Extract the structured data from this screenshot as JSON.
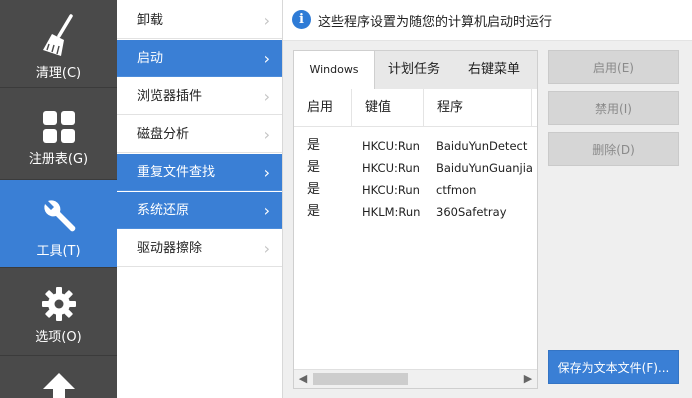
{
  "left_nav": [
    {
      "label": "清理(C)",
      "icon": "broom-icon"
    },
    {
      "label": "注册表(G)",
      "icon": "grid-icon"
    },
    {
      "label": "工具(T)",
      "icon": "wrench-icon",
      "active": true
    },
    {
      "label": "选项(O)",
      "icon": "gear-icon"
    },
    {
      "label": "",
      "icon": "up-arrow-icon"
    }
  ],
  "tools_nav": [
    {
      "label": "卸载"
    },
    {
      "label": "启动",
      "active": true
    },
    {
      "label": "浏览器插件"
    },
    {
      "label": "磁盘分析"
    },
    {
      "label": "重复文件查找",
      "active": true
    },
    {
      "label": "系统还原",
      "active": true
    },
    {
      "label": "驱动器擦除"
    }
  ],
  "info": {
    "text": "这些程序设置为随您的计算机启动时运行"
  },
  "tabs": [
    {
      "label": "Windows",
      "active": true
    },
    {
      "label": "计划任务"
    },
    {
      "label": "右键菜单"
    }
  ],
  "table": {
    "columns": [
      "启用",
      "键值",
      "程序"
    ],
    "rows": [
      {
        "enabled": "是",
        "key": "HKCU:Run",
        "program": "BaiduYunDetect"
      },
      {
        "enabled": "是",
        "key": "HKCU:Run",
        "program": "BaiduYunGuanjia"
      },
      {
        "enabled": "是",
        "key": "HKCU:Run",
        "program": "ctfmon"
      },
      {
        "enabled": "是",
        "key": "HKLM:Run",
        "program": "360Safetray"
      }
    ]
  },
  "buttons": {
    "enable": "启用(E)",
    "disable": "禁用(I)",
    "delete": "删除(D)",
    "save": "保存为文本文件(F)..."
  },
  "colors": {
    "accent": "#3a7fd5",
    "sidebar": "#4a4a4a"
  }
}
